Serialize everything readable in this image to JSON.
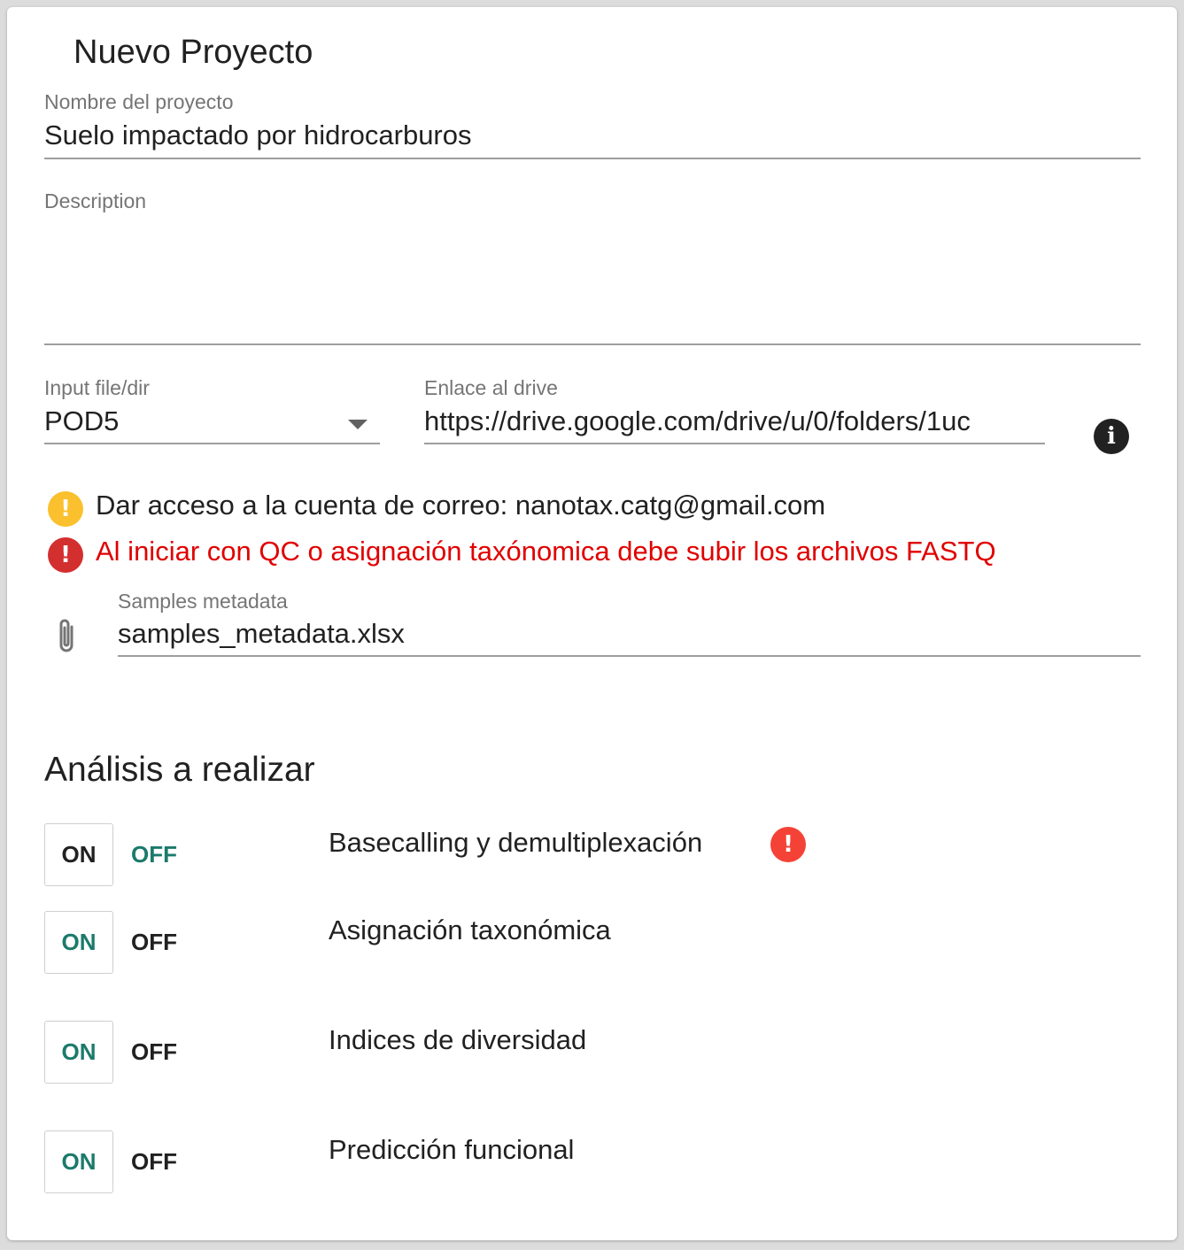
{
  "form": {
    "title": "Nuevo Proyecto",
    "project_name": {
      "label": "Nombre del proyecto",
      "value": "Suelo impactado por hidrocarburos"
    },
    "description": {
      "label": "Description",
      "value": ""
    },
    "input_type": {
      "label": "Input file/dir",
      "value": "POD5"
    },
    "drive_link": {
      "label": "Enlace al drive",
      "value": "https://drive.google.com/drive/u/0/folders/1uc"
    },
    "notices": [
      {
        "type": "warning",
        "text": "Dar acceso a la cuenta de correo: nanotax.catg@gmail.com",
        "icon": "warning-icon",
        "color": "#fbc02d"
      },
      {
        "type": "error",
        "text": "Al iniciar con QC o asignación taxónomica debe subir los archivos FASTQ",
        "icon": "error-icon",
        "color": "#e00000"
      }
    ],
    "samples_metadata": {
      "label": "Samples metadata",
      "value": "samples_metadata.xlsx",
      "icon": "paperclip-icon"
    }
  },
  "analysis": {
    "title": "Análisis a realizar",
    "on_label": "ON",
    "off_label": "OFF",
    "active_color": "#1b7a6b",
    "items": [
      {
        "label": "Basecalling y demultiplexación",
        "state": "off",
        "error": true
      },
      {
        "label": "Asignación taxonómica",
        "state": "on",
        "error": false
      },
      {
        "label": "Indices de diversidad",
        "state": "on",
        "error": false
      },
      {
        "label": "Predicción funcional",
        "state": "on",
        "error": false
      }
    ]
  }
}
